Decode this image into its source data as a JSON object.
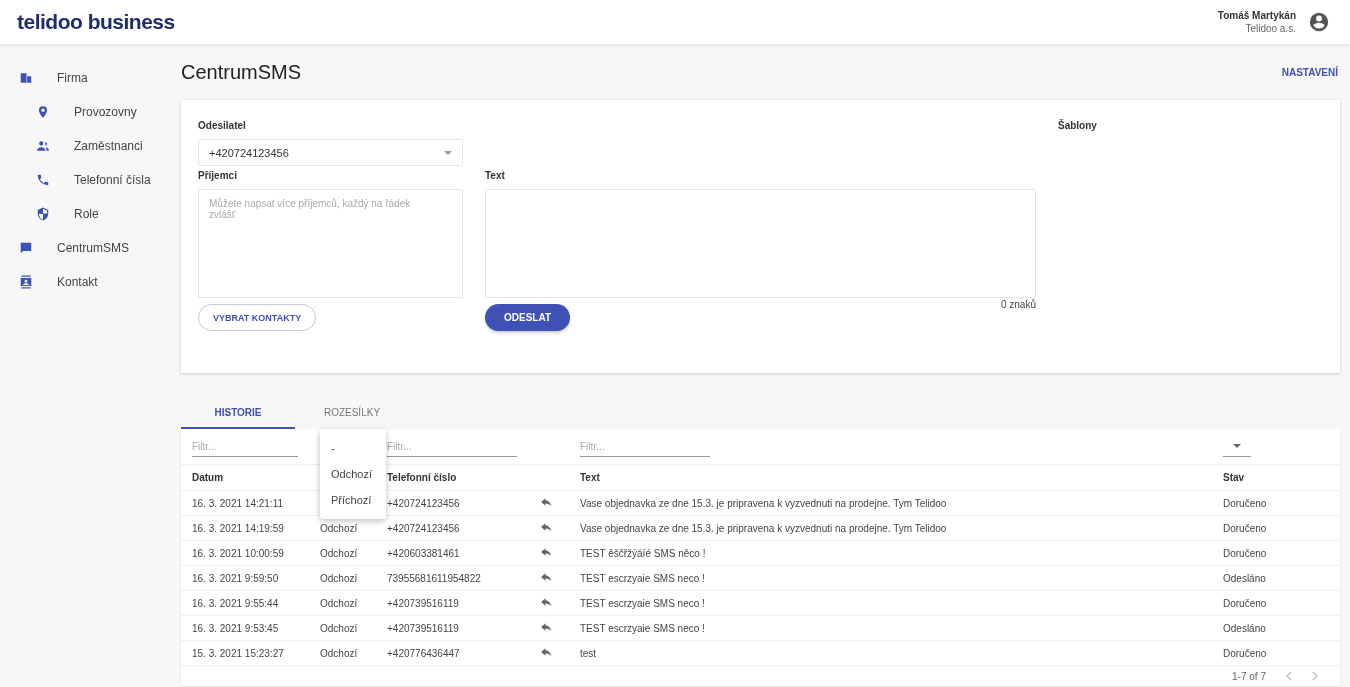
{
  "header": {
    "logo": "telidoo business",
    "user_name": "Tomáš Martykán",
    "company": "Telidoo a.s."
  },
  "sidebar": {
    "items": [
      {
        "label": "Firma",
        "children": [
          {
            "label": "Provozovny"
          },
          {
            "label": "Zaměstnanci"
          },
          {
            "label": "Telefonní čísla"
          },
          {
            "label": "Role"
          }
        ]
      },
      {
        "label": "CentrumSMS"
      },
      {
        "label": "Kontakt"
      }
    ]
  },
  "page": {
    "title": "CentrumSMS",
    "settings_link": "NASTAVENÍ"
  },
  "form": {
    "sender_label": "Odesilatel",
    "sender_value": "+420724123456",
    "recipients_label": "Příjemci",
    "recipients_placeholder": "Můžete napsat více příjemců, každý na řádek zvlášť",
    "text_label": "Text",
    "char_count": "0 znaků",
    "contacts_button": "VYBRAT KONTAKTY",
    "send_button": "ODESLAT",
    "templates_label": "Šablony"
  },
  "tabs": [
    {
      "label": "HISTORIE",
      "selected": true
    },
    {
      "label": "ROZESÍLKY",
      "selected": false
    }
  ],
  "table": {
    "filters": [
      {
        "kind": "text",
        "placeholder": "Filtr..."
      },
      {
        "kind": "menu",
        "options": [
          "-",
          "Odchozí",
          "Příchozí"
        ]
      },
      {
        "kind": "text",
        "placeholder": "Filtr..."
      },
      {
        "kind": "none"
      },
      {
        "kind": "text",
        "placeholder": "Filtr..."
      },
      {
        "kind": "select"
      }
    ],
    "columns": {
      "date": "Datum",
      "phone": "Telefonní číslo",
      "text": "Text",
      "status": "Stav"
    },
    "rows": [
      {
        "date": "16. 3. 2021 14:21:11",
        "phone": "+420724123456",
        "text": "Vase objednavka ze dne 15.3. je pripravena k vyzvednuti na prodejne. Tym Telidoo",
        "status": "Doručeno"
      },
      {
        "date": "16. 3. 2021 14:19:59",
        "direction": "Odchozí",
        "phone": "+420724123456",
        "text": "Vase objednavka ze dne 15.3. je pripravena k vyzvednuti na prodejne. Tym Telidoo",
        "status": "Doručeno"
      },
      {
        "date": "16. 3. 2021 10:00:59",
        "direction": "Odchozí",
        "phone": "+420603381461",
        "text": "TEST ěščřžýáíé SMS něco !",
        "status": "Doručeno"
      },
      {
        "date": "16. 3. 2021 9:59:50",
        "direction": "Odchozí",
        "phone": "73955681611954822",
        "text": "TEST escrzyaie SMS neco !",
        "status": "Odesláno"
      },
      {
        "date": "16. 3. 2021 9:55:44",
        "direction": "Odchozí",
        "phone": "+420739516119",
        "text": "TEST escrzyaie SMS neco !",
        "status": "Doručeno"
      },
      {
        "date": "16. 3. 2021 9:53:45",
        "direction": "Odchozí",
        "phone": "+420739516119",
        "text": "TEST escrzyaie SMS neco !",
        "status": "Odesláno"
      },
      {
        "date": "15. 3. 2021 15:23:27",
        "direction": "Odchozí",
        "phone": "+420776436447",
        "text": "test",
        "status": "Doručeno"
      }
    ],
    "pagination": "1-7 of 7"
  }
}
